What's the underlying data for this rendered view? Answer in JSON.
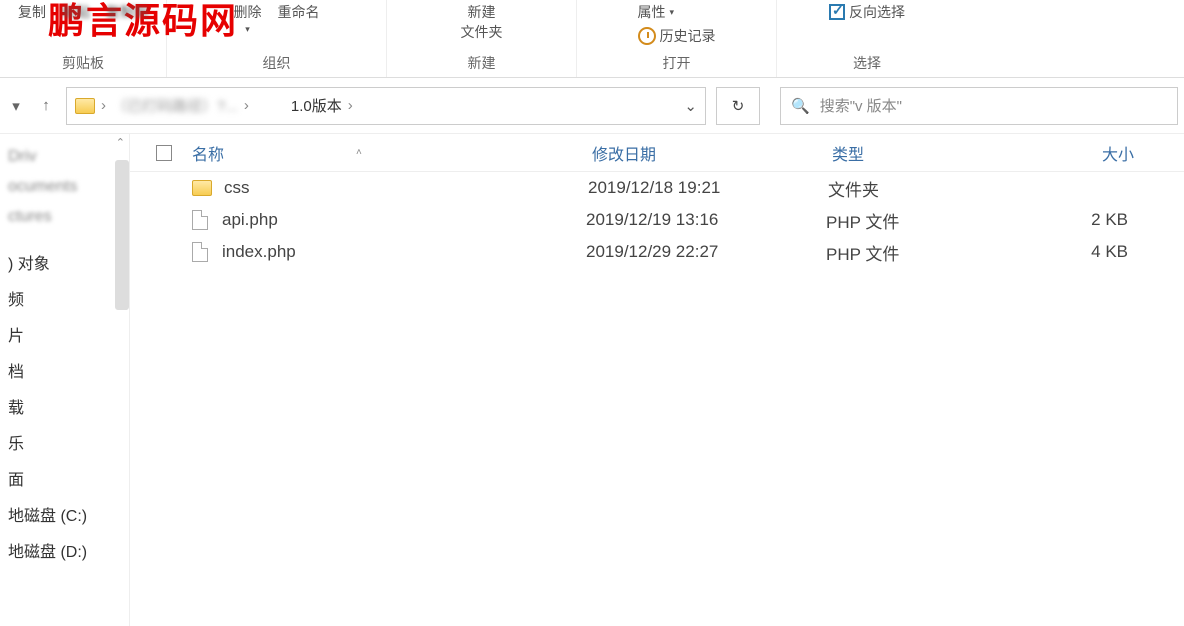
{
  "watermark": "鹏言源码网",
  "ribbon": {
    "groups": {
      "clipboard": {
        "label": "剪贴板",
        "copy": "复制",
        "paste": "粘贴",
        "copyTo": "复制到"
      },
      "organize": {
        "label": "组织",
        "delete": "删除",
        "rename": "重命名"
      },
      "new": {
        "label": "新建",
        "newFolder": "新建\n文件夹"
      },
      "open": {
        "label": "打开",
        "properties": "属性",
        "history": "历史记录"
      },
      "select": {
        "label": "选择",
        "invert": "反向选择"
      }
    }
  },
  "breadcrumb": {
    "obscured": "（已打码路径）?...",
    "parts": [
      "",
      "1.0版本"
    ],
    "searchPlaceholder": "搜索\"v               版本\""
  },
  "columns": {
    "name": "名称",
    "date": "修改日期",
    "type": "类型",
    "size": "大小"
  },
  "files": [
    {
      "icon": "folder",
      "name": "css",
      "date": "2019/12/18 19:21",
      "type": "文件夹",
      "size": ""
    },
    {
      "icon": "file",
      "name": "api.php",
      "date": "2019/12/19 13:16",
      "type": "PHP 文件",
      "size": "2 KB"
    },
    {
      "icon": "file",
      "name": "index.php",
      "date": "2019/12/29 22:27",
      "type": "PHP 文件",
      "size": "4 KB"
    }
  ],
  "sidebar": [
    {
      "label": "Driv",
      "blur": true
    },
    {
      "label": "ocuments",
      "blur": true
    },
    {
      "label": "ctures",
      "blur": true
    },
    {
      "label": "",
      "blur": true
    },
    {
      "label": ") 对象",
      "blur": false
    },
    {
      "label": "频",
      "blur": false
    },
    {
      "label": "片",
      "blur": false
    },
    {
      "label": "档",
      "blur": false
    },
    {
      "label": "载",
      "blur": false
    },
    {
      "label": "乐",
      "blur": false
    },
    {
      "label": "面",
      "blur": false
    },
    {
      "label": "地磁盘 (C:)",
      "blur": false
    },
    {
      "label": "地磁盘 (D:)",
      "blur": false
    }
  ]
}
